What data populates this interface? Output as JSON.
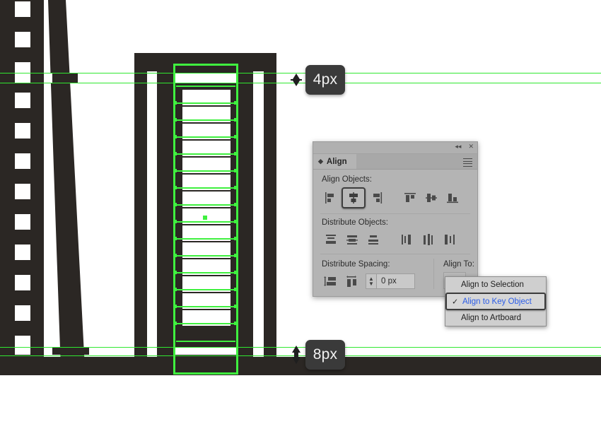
{
  "app": {
    "kind": "vector-illustration-editor",
    "canvas_background": "#ffffff",
    "artwork_color": "#2b2724",
    "guide_color": "#30e830",
    "selection_color": "#3ff03f"
  },
  "measurements": [
    {
      "id": "top",
      "label": "4px",
      "icon": "vertical-double-arrow-icon"
    },
    {
      "id": "bottom",
      "label": "8px",
      "icon": "vertical-double-arrow-icon"
    }
  ],
  "align_panel": {
    "title": "Align",
    "titlebar_icons": [
      {
        "name": "collapse-icon",
        "glyph": "◂◂"
      },
      {
        "name": "close-icon",
        "glyph": "✕"
      }
    ],
    "panel_menu_icon": "hamburger-menu-icon",
    "tab_toggle_icon": "collapse-toggle-icon",
    "sections": [
      {
        "id": "align-objects",
        "label": "Align Objects:",
        "buttons": [
          {
            "name": "align-left-edges",
            "selected": false
          },
          {
            "name": "align-horizontal-centers",
            "selected": true
          },
          {
            "name": "align-right-edges",
            "selected": false
          },
          {
            "name": "align-top-edges",
            "selected": false
          },
          {
            "name": "align-vertical-centers",
            "selected": false
          },
          {
            "name": "align-bottom-edges",
            "selected": false
          }
        ]
      },
      {
        "id": "distribute-objects",
        "label": "Distribute Objects:",
        "buttons": [
          {
            "name": "distribute-top-edges",
            "selected": false
          },
          {
            "name": "distribute-vertical-centers",
            "selected": false
          },
          {
            "name": "distribute-bottom-edges",
            "selected": false
          },
          {
            "name": "distribute-left-edges",
            "selected": false
          },
          {
            "name": "distribute-horizontal-centers",
            "selected": false
          },
          {
            "name": "distribute-right-edges",
            "selected": false
          }
        ]
      }
    ],
    "distribute_spacing": {
      "label": "Distribute Spacing:",
      "buttons": [
        {
          "name": "vertical-distribute-spacing",
          "selected": false
        },
        {
          "name": "horizontal-distribute-spacing",
          "selected": false
        }
      ],
      "value": "0 px",
      "stepper_up_glyph": "▲",
      "stepper_down_glyph": "▼"
    },
    "align_to": {
      "label": "Align To:",
      "button_icon": "align-to-key-object-icon",
      "chevron": "⌄"
    }
  },
  "align_to_menu": {
    "items": [
      {
        "label": "Align to Selection",
        "checked": false,
        "highlighted": false
      },
      {
        "label": "Align to Key Object",
        "checked": true,
        "highlighted": true
      },
      {
        "label": "Align to Artboard",
        "checked": false,
        "highlighted": false
      }
    ],
    "check_glyph": "✓",
    "highlight_text_color": "#2a5ce8"
  }
}
